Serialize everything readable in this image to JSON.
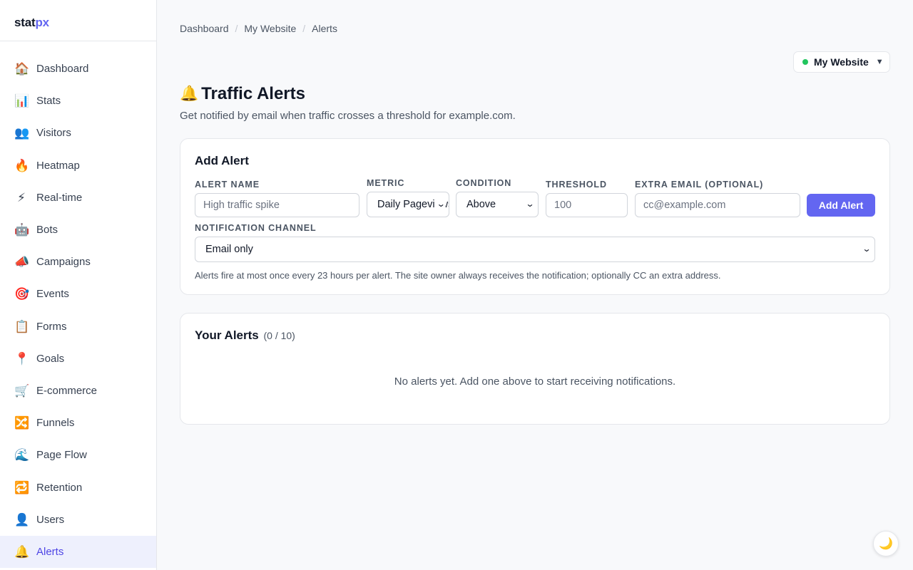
{
  "brand": {
    "part1": "stat",
    "part2": "px"
  },
  "sidebar": {
    "items": [
      {
        "icon": "🏠",
        "label": "Dashboard",
        "icon_name": "home-icon"
      },
      {
        "icon": "📊",
        "label": "Stats",
        "icon_name": "bar-chart-icon"
      },
      {
        "icon": "👥",
        "label": "Visitors",
        "icon_name": "people-icon"
      },
      {
        "icon": "🔥",
        "label": "Heatmap",
        "icon_name": "fire-icon"
      },
      {
        "icon": "⚡",
        "label": "Real-time",
        "icon_name": "lightning-icon"
      },
      {
        "icon": "🤖",
        "label": "Bots",
        "icon_name": "robot-icon"
      },
      {
        "icon": "📣",
        "label": "Campaigns",
        "icon_name": "megaphone-icon"
      },
      {
        "icon": "🎯",
        "label": "Events",
        "icon_name": "target-icon"
      },
      {
        "icon": "📋",
        "label": "Forms",
        "icon_name": "clipboard-icon"
      },
      {
        "icon": "📍",
        "label": "Goals",
        "icon_name": "pin-icon"
      },
      {
        "icon": "🛒",
        "label": "E-commerce",
        "icon_name": "cart-icon"
      },
      {
        "icon": "🔀",
        "label": "Funnels",
        "icon_name": "shuffle-icon"
      },
      {
        "icon": "🌊",
        "label": "Page Flow",
        "icon_name": "wave-icon"
      },
      {
        "icon": "🔁",
        "label": "Retention",
        "icon_name": "repeat-icon"
      },
      {
        "icon": "👤",
        "label": "Users",
        "icon_name": "user-icon"
      },
      {
        "icon": "🔔",
        "label": "Alerts",
        "icon_name": "bell-icon",
        "active": true
      }
    ]
  },
  "breadcrumb": [
    "Dashboard",
    "My Website",
    "Alerts"
  ],
  "site_selector": {
    "label": "My Website",
    "status_color": "#22c55e"
  },
  "page": {
    "icon": "🔔",
    "title": "Traffic Alerts",
    "subtitle": "Get notified by email when traffic crosses a threshold for example.com."
  },
  "add_alert": {
    "heading": "Add Alert",
    "alert_name": {
      "label": "ALERT NAME",
      "placeholder": "High traffic spike"
    },
    "metric": {
      "label": "METRIC",
      "value": "Daily Pageviews"
    },
    "condition": {
      "label": "CONDITION",
      "value": "Above"
    },
    "threshold": {
      "label": "THRESHOLD",
      "placeholder": "100"
    },
    "extra_email": {
      "label": "EXTRA EMAIL (OPTIONAL)",
      "placeholder": "cc@example.com"
    },
    "button": "Add Alert",
    "channel": {
      "label": "NOTIFICATION CHANNEL",
      "value": "Email only"
    },
    "hint": "Alerts fire at most once every 23 hours per alert. The site owner always receives the notification; optionally CC an extra address."
  },
  "your_alerts": {
    "heading": "Your Alerts",
    "count": "(0 / 10)",
    "empty": "No alerts yet. Add one above to start receiving notifications."
  },
  "theme_toggle": {
    "icon": "🌙"
  },
  "colors": {
    "accent": "#6366f1",
    "active_bg": "#eef0fd"
  }
}
